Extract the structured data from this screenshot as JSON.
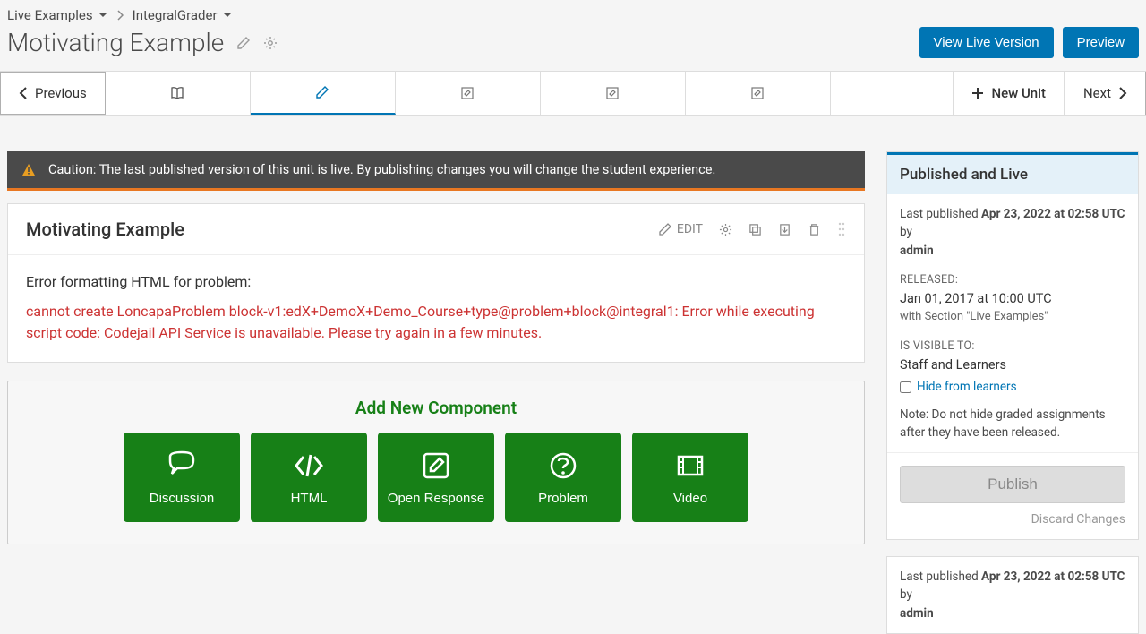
{
  "breadcrumbs": {
    "item1": "Live Examples",
    "item2": "IntegralGrader"
  },
  "page_title": "Motivating Example",
  "header_buttons": {
    "view_live": "View Live Version",
    "preview": "Preview"
  },
  "unit_nav": {
    "previous": "Previous",
    "new_unit": "New Unit",
    "next": "Next"
  },
  "caution": "Caution: The last published version of this unit is live. By publishing changes you will change the student experience.",
  "unit_card": {
    "title": "Motivating Example",
    "edit": "EDIT",
    "error_lead": "Error formatting HTML for problem:",
    "error_msg": "cannot create LoncapaProblem block-v1:edX+DemoX+Demo_Course+type@problem+block@integral1: Error while executing script code: Codejail API Service is unavailable. Please try again in a few minutes."
  },
  "add_component": {
    "title": "Add New Component",
    "items": [
      "Discussion",
      "HTML",
      "Open Response",
      "Problem",
      "Video"
    ]
  },
  "sidebar": {
    "panel_title": "Published and Live",
    "last_pub_prefix": "Last published ",
    "last_pub_date": "Apr 23, 2022 at 02:58 UTC",
    "by_text": " by ",
    "by_user": "admin",
    "released_label": "RELEASED:",
    "released_date": "Jan 01, 2017 at 10:00 UTC",
    "released_with": "with Section \"Live Examples\"",
    "visible_label": "IS VISIBLE TO:",
    "visible_val": "Staff and Learners",
    "hide_link": "Hide from learners",
    "note": "Note: Do not hide graded assignments after they have been released.",
    "publish_btn": "Publish",
    "discard": "Discard Changes"
  },
  "sidebar2": {
    "last_pub_prefix": "Last published ",
    "last_pub_date": "Apr 23, 2022 at 02:58 UTC",
    "by_text": " by ",
    "by_user": "admin"
  }
}
